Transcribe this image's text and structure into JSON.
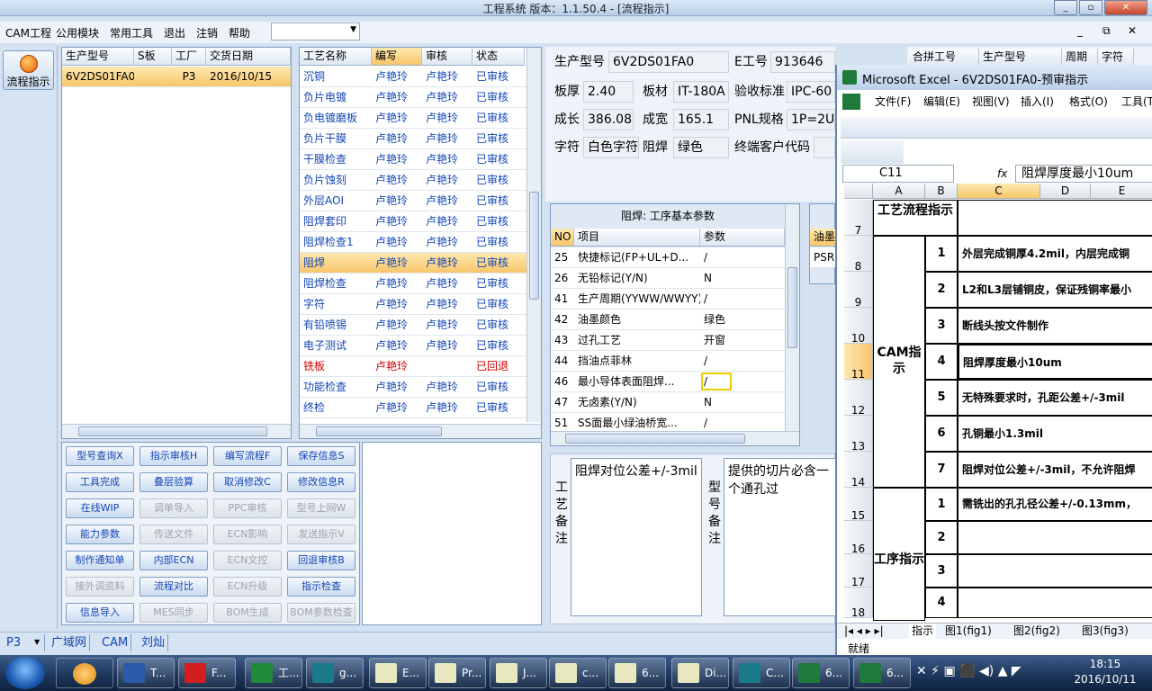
{
  "app": {
    "title": "工程系统  版本：1.1.50.4 - [流程指示]",
    "window_controls": [
      "_",
      "▫",
      "✕"
    ],
    "mdi_controls": [
      "_",
      "⧉",
      "✕"
    ]
  },
  "menu": [
    "CAM工程",
    "公用模块",
    "常用工具",
    "退出",
    "注销",
    "帮助"
  ],
  "sidebar": {
    "button_label": "流程指示"
  },
  "order_table": {
    "headers": [
      "生产型号",
      "S板",
      "工厂",
      "交货日期"
    ],
    "rows": [
      {
        "model": "6V2DS01FA0",
        "sb": "",
        "factory": "P3",
        "date": "2016/10/15"
      }
    ]
  },
  "process_table": {
    "headers": [
      "工艺名称",
      "编写",
      "审核",
      "状态"
    ],
    "rows": [
      {
        "name": "沉铜",
        "writer": "卢艳玲",
        "reviewer": "卢艳玲",
        "status": "已审核"
      },
      {
        "name": "负片电镀",
        "writer": "卢艳玲",
        "reviewer": "卢艳玲",
        "status": "已审核"
      },
      {
        "name": "负电镀磨板",
        "writer": "卢艳玲",
        "reviewer": "卢艳玲",
        "status": "已审核"
      },
      {
        "name": "负片干膜",
        "writer": "卢艳玲",
        "reviewer": "卢艳玲",
        "status": "已审核"
      },
      {
        "name": "干膜检查",
        "writer": "卢艳玲",
        "reviewer": "卢艳玲",
        "status": "已审核"
      },
      {
        "name": "负片蚀刻",
        "writer": "卢艳玲",
        "reviewer": "卢艳玲",
        "status": "已审核"
      },
      {
        "name": "外层AOI",
        "writer": "卢艳玲",
        "reviewer": "卢艳玲",
        "status": "已审核"
      },
      {
        "name": "阻焊套印",
        "writer": "卢艳玲",
        "reviewer": "卢艳玲",
        "status": "已审核"
      },
      {
        "name": "阻焊检查1",
        "writer": "卢艳玲",
        "reviewer": "卢艳玲",
        "status": "已审核"
      },
      {
        "name": "阻焊",
        "writer": "卢艳玲",
        "reviewer": "卢艳玲",
        "status": "已审核"
      },
      {
        "name": "阻焊检查",
        "writer": "卢艳玲",
        "reviewer": "卢艳玲",
        "status": "已审核"
      },
      {
        "name": "字符",
        "writer": "卢艳玲",
        "reviewer": "卢艳玲",
        "status": "已审核"
      },
      {
        "name": "有铅喷锡",
        "writer": "卢艳玲",
        "reviewer": "卢艳玲",
        "status": "已审核"
      },
      {
        "name": "电子测试",
        "writer": "卢艳玲",
        "reviewer": "卢艳玲",
        "status": "已审核"
      },
      {
        "name": "铣板",
        "writer": "卢艳玲",
        "reviewer": "",
        "status": "已回退"
      },
      {
        "name": "功能检查",
        "writer": "卢艳玲",
        "reviewer": "卢艳玲",
        "status": "已审核"
      },
      {
        "name": "终检",
        "writer": "卢艳玲",
        "reviewer": "卢艳玲",
        "status": "已审核"
      }
    ]
  },
  "buttons": [
    [
      "型号查询X",
      "指示审核H",
      "编写流程F",
      "保存信息S"
    ],
    [
      "工具完成",
      "叠层验算",
      "取消修改C",
      "修改信息R"
    ],
    [
      "在线WIP",
      "调单导入",
      "PPC审核",
      "型号上网W"
    ],
    [
      "能力参数",
      "传送文件",
      "ECN影响",
      "发送指示V"
    ],
    [
      "制作通知单",
      "内部ECN",
      "ECN文控",
      "回退审核B"
    ],
    [
      "接外调资料",
      "流程对比",
      "ECN升级",
      "指示检查"
    ],
    [
      "信息导入",
      "MES同步",
      "BOM生成",
      "BOM参数检查"
    ]
  ],
  "button_disabled": [
    [
      false,
      false,
      false,
      false
    ],
    [
      false,
      false,
      false,
      false
    ],
    [
      false,
      true,
      true,
      true
    ],
    [
      false,
      true,
      true,
      true
    ],
    [
      false,
      false,
      true,
      false
    ],
    [
      true,
      false,
      true,
      false
    ],
    [
      false,
      true,
      true,
      true
    ]
  ],
  "info": {
    "model_label": "生产型号",
    "model_value": "6V2DS01FA0",
    "eno_label": "E工号",
    "eno_value": "913646",
    "thick_label": "板厚",
    "thick_value": "2.40",
    "material_label": "板材",
    "material_value": "IT-180A",
    "standard_label": "验收标准",
    "standard_value": "IPC-60",
    "length_label": "成长",
    "length_value": "386.08",
    "width_label": "成宽",
    "width_value": "165.1",
    "pnl_label": "PNL规格",
    "pnl_value": "1P=2U",
    "char_label": "字符",
    "char_value": "白色字符",
    "mask_label": "阻焊",
    "mask_value": "绿色",
    "customer_label": "终端客户代码",
    "right_table_headers": [
      "合拼工号",
      "生产型号",
      "周期",
      "字符"
    ]
  },
  "param_panel": {
    "title": "阻焊: 工序基本参数",
    "headers": [
      "NO",
      "项目",
      "参数"
    ],
    "rows": [
      {
        "no": "25",
        "item": "快捷标记(FP+UL+D...",
        "value": "/"
      },
      {
        "no": "26",
        "item": "无铅标记(Y/N)",
        "value": "N"
      },
      {
        "no": "41",
        "item": "生产周期(YYWW/WWYY)",
        "value": "/"
      },
      {
        "no": "42",
        "item": "油墨颜色",
        "value": "绿色"
      },
      {
        "no": "43",
        "item": "过孔工艺",
        "value": "开窗"
      },
      {
        "no": "44",
        "item": "挡油点菲林",
        "value": "/"
      },
      {
        "no": "46",
        "item": "最小导体表面阻焊...",
        "value": "/"
      },
      {
        "no": "47",
        "item": "无卤素(Y/N)",
        "value": "N"
      },
      {
        "no": "51",
        "item": "SS面最小绿油桥宽...",
        "value": "/"
      }
    ],
    "side_header_1": "油墨",
    "side_header_2": "PSR"
  },
  "remarks": {
    "process_label": "工艺备注",
    "process_text": "阻焊对位公差+/-3mil",
    "model_label": "型号备注",
    "model_text": "提供的切片必含一个通孔过"
  },
  "statusbar": {
    "items": [
      "P3",
      "广域网",
      "CAM",
      "刘灿"
    ]
  },
  "excel": {
    "title": "Microsoft Excel - 6V2DS01FA0-预审指示",
    "menu": [
      "文件(F)",
      "编辑(E)",
      "视图(V)",
      "插入(I)",
      "格式(O)",
      "工具(T"
    ],
    "name_box": "C11",
    "fx": "fx",
    "formula": "阻焊厚度最小10um",
    "columns": [
      "A",
      "B",
      "C",
      "D",
      "E"
    ],
    "row_numbers": [
      "7",
      "8",
      "9",
      "10",
      "11",
      "12",
      "13",
      "14",
      "15",
      "16",
      "17",
      "18"
    ],
    "header_cell": "工艺流程指示",
    "cam_label": "CAM指示",
    "proc_label": "工序指示",
    "items": [
      {
        "no": "1",
        "text": "外层完成铜厚4.2mil，内层完成铜"
      },
      {
        "no": "2",
        "text": "L2和L3层铺铜皮，保证残铜率最小"
      },
      {
        "no": "3",
        "text": "断线头按文件制作"
      },
      {
        "no": "4",
        "text": "阻焊厚度最小10um"
      },
      {
        "no": "5",
        "text": "无特殊要求时，孔距公差+/-3mil"
      },
      {
        "no": "6",
        "text": "孔铜最小1.3mil"
      },
      {
        "no": "7",
        "text": "阻焊对位公差+/-3mil，不允许阻焊"
      },
      {
        "no": "1",
        "text": "需铣出的孔孔径公差+/-0.13mm，"
      },
      {
        "no": "2",
        "text": ""
      },
      {
        "no": "3",
        "text": ""
      },
      {
        "no": "4",
        "text": ""
      }
    ],
    "sheet_tabs": [
      "指示",
      "图1(fig1)",
      "图2(fig2)",
      "图3(fig3)"
    ],
    "status": "就绪"
  },
  "taskbar": {
    "items": [
      "T...",
      "F...",
      "工...",
      "g...",
      "E...",
      "Pr...",
      "J...",
      "c...",
      "6...",
      "Di...",
      "C...",
      "6...",
      "6..."
    ],
    "time": "18:15",
    "date": "2016/10/11"
  }
}
